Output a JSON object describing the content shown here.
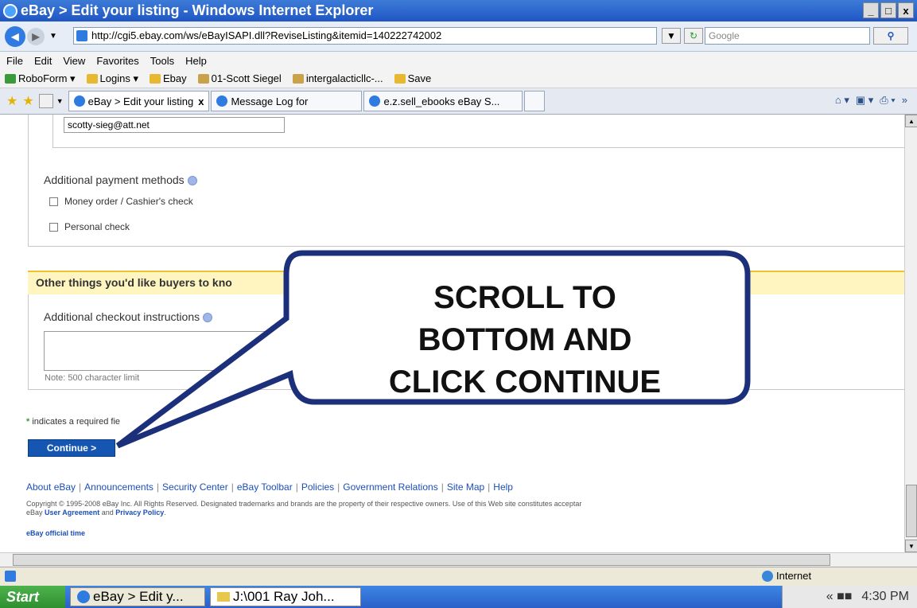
{
  "window": {
    "title": "eBay > Edit your listing - Windows Internet Explorer",
    "min": "_",
    "max": "□",
    "close": "x"
  },
  "address": {
    "url": "http://cgi5.ebay.com/ws/eBayISAPI.dll?ReviseListing&itemid=140222742002",
    "search_placeholder": "Google"
  },
  "menu": [
    "File",
    "Edit",
    "View",
    "Favorites",
    "Tools",
    "Help"
  ],
  "links": [
    "RoboForm ▾",
    "Logins ▾",
    "Ebay",
    "01-Scott Siegel",
    "intergalacticllc-...",
    "Save"
  ],
  "tabs": [
    {
      "label": "eBay > Edit your listing",
      "close": "x"
    },
    {
      "label": "Message Log for"
    },
    {
      "label": "e.z.sell_ebooks eBay S..."
    }
  ],
  "form": {
    "email": "scotty-sieg@att.net",
    "additional_payment_label": "Additional payment methods",
    "checkbox_money_order": "Money order / Cashier's check",
    "checkbox_personal_check": "Personal check",
    "section_header": "Other things you'd like buyers to kno",
    "checkout_instructions_label": "Additional checkout instructions",
    "note": "Note: 500 character limit",
    "required_star": "*",
    "required_text": " indicates a required fie",
    "continue_label": "Continue >"
  },
  "footer": {
    "links": [
      "About eBay",
      "Announcements",
      "Security Center",
      "eBay Toolbar",
      "Policies",
      "Government Relations",
      "Site Map",
      "Help"
    ],
    "copyright_line1": "Copyright © 1995-2008 eBay Inc. All Rights Reserved. Designated trademarks and brands are the property of their respective owners. Use of this Web site constitutes acceptar",
    "copyright_line2_prefix": "eBay ",
    "user_agreement": "User Agreement",
    "and": " and ",
    "privacy_policy": "Privacy Policy",
    "official_time": "eBay official time"
  },
  "status": {
    "zone": "Internet"
  },
  "taskbar": {
    "start": "Start",
    "task1": "eBay > Edit y...",
    "task2": "J:\\001 Ray Joh...",
    "clock": "4:30 PM"
  },
  "callout": {
    "line1": "SCROLL TO",
    "line2": "BOTTOM AND",
    "line3": "CLICK CONTINUE"
  },
  "colors": {
    "ie_blue": "#1f56c4",
    "continue_button": "#1656b3",
    "section_header_bg": "#fff5c0",
    "callout_fill": "#ffffff",
    "callout_stroke": "#1c2f7a"
  }
}
